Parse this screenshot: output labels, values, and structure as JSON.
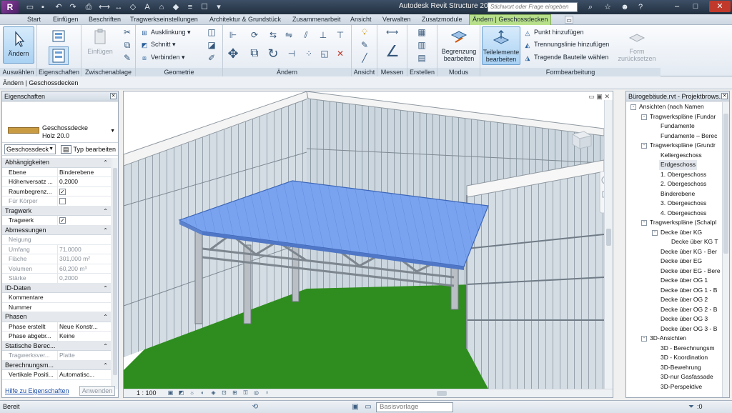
{
  "title_bar": {
    "logo_letter": "R",
    "window_title": "Autodesk Revit Structure 20...",
    "search_placeholder": "Stichwort oder Frage eingeben",
    "qat_icons": [
      "open-icon",
      "save-icon",
      "undo-icon",
      "redo-icon",
      "print-icon",
      "measure-icon",
      "dimension-icon",
      "tag-icon",
      "text-icon",
      "3d-view-icon",
      "section-icon",
      "thin-lines-icon",
      "close-hidden-icon",
      "switch-windows-icon"
    ],
    "right_icons": [
      "binoculars-icon",
      "star-icon",
      "user-icon",
      "help-icon"
    ]
  },
  "tabs": [
    {
      "label": "Start"
    },
    {
      "label": "Einfügen"
    },
    {
      "label": "Beschriften"
    },
    {
      "label": "Tragwerkseinstellungen"
    },
    {
      "label": "Architektur & Grundstück"
    },
    {
      "label": "Zusammenarbeit"
    },
    {
      "label": "Ansicht"
    },
    {
      "label": "Verwalten"
    },
    {
      "label": "Zusatzmodule"
    },
    {
      "label": "Ändern | Geschossdecken"
    }
  ],
  "ribbon": {
    "panels": [
      {
        "label": "Auswählen"
      },
      {
        "label": "Eigenschaften"
      },
      {
        "label": "Zwischenablage"
      },
      {
        "label": "Geometrie"
      },
      {
        "label": "Ändern"
      },
      {
        "label": "Ansicht"
      },
      {
        "label": "Messen"
      },
      {
        "label": "Erstellen"
      },
      {
        "label": "Modus"
      },
      {
        "label": "Formbearbeitung"
      }
    ],
    "modify_btn": "Ändern",
    "paste_btn": "Einfügen",
    "geometry": {
      "cope": "Ausklinkung",
      "cut": "Schnitt",
      "join": "Verbinden"
    },
    "mode": {
      "boundary_l1": "Begrenzung",
      "boundary_l2": "bearbeiten"
    },
    "shape": {
      "subelements_l1": "Teilelemente",
      "subelements_l2": "bearbeiten",
      "add_point": "Punkt hinzufügen",
      "add_split_line": "Trennungslinie hinzufügen",
      "pick_supports": "Tragende Bauteile wählen",
      "reset_l1": "Form",
      "reset_l2": "zurücksetzen"
    }
  },
  "context_bar": "Ändern | Geschossdecken",
  "properties": {
    "title": "Eigenschaften",
    "type_name": "Geschossdecke",
    "type_sub": "Holz 20.0",
    "instance_filter": "Geschossdeck",
    "edit_type": "Typ bearbeiten",
    "rows": [
      {
        "group": "Abhängigkeiten"
      },
      {
        "k": "Ebene",
        "v": "Binderebene"
      },
      {
        "k": "Höhenversatz ...",
        "v": "0,2000"
      },
      {
        "k": "Raumbegrenz...",
        "v": "",
        "check": true,
        "checked": true
      },
      {
        "k": "Für Körper",
        "v": "",
        "check": true,
        "checked": false,
        "grey": true
      },
      {
        "group": "Tragwerk"
      },
      {
        "k": "Tragwerk",
        "v": "",
        "check": true,
        "checked": true
      },
      {
        "group": "Abmessungen"
      },
      {
        "k": "Neigung",
        "v": "",
        "grey": true
      },
      {
        "k": "Umfang",
        "v": "71,0000",
        "grey": true
      },
      {
        "k": "Fläche",
        "v": "301,000 m²",
        "grey": true
      },
      {
        "k": "Volumen",
        "v": "60,200 m³",
        "grey": true
      },
      {
        "k": "Stärke",
        "v": "0,2000",
        "grey": true
      },
      {
        "group": "ID-Daten"
      },
      {
        "k": "Kommentare",
        "v": ""
      },
      {
        "k": "Nummer",
        "v": ""
      },
      {
        "group": "Phasen"
      },
      {
        "k": "Phase erstellt",
        "v": "Neue Konstr..."
      },
      {
        "k": "Phase abgebr...",
        "v": "Keine"
      },
      {
        "group": "Statische Berec..."
      },
      {
        "k": "Tragwerksver...",
        "v": "Platte",
        "grey": true
      },
      {
        "group": "Berechnungsm..."
      },
      {
        "k": "Vertikale Positi...",
        "v": "Automatisc..."
      }
    ],
    "help_link": "Hilfe zu Eigenschaften",
    "apply_btn": "Anwenden"
  },
  "view": {
    "scale": "1 : 100",
    "colors": {
      "floor": "#2f8d1f",
      "slab": "#7aa3ef",
      "glass": "#c9d5de",
      "frame": "#9aa4ab"
    }
  },
  "browser": {
    "title": "Bürogebäude.rvt - Projektbrows...",
    "tree": [
      {
        "lvl": 0,
        "exp": "-",
        "label": "Ansichten (nach Namen"
      },
      {
        "lvl": 1,
        "exp": "-",
        "label": "Tragwerkspläne (Fundar"
      },
      {
        "lvl": 2,
        "label": "Fundamente"
      },
      {
        "lvl": 2,
        "label": "Fundamente – Berec"
      },
      {
        "lvl": 1,
        "exp": "-",
        "label": "Tragwerkspläne (Grundr"
      },
      {
        "lvl": 2,
        "label": "Kellergeschoss"
      },
      {
        "lvl": 2,
        "label": "Erdgeschoss",
        "sel": true
      },
      {
        "lvl": 2,
        "label": "1. Obergeschoss"
      },
      {
        "lvl": 2,
        "label": "2. Obergeschoss"
      },
      {
        "lvl": 2,
        "label": "Binderebene"
      },
      {
        "lvl": 2,
        "label": "3. Obergeschoss"
      },
      {
        "lvl": 2,
        "label": "4. Obergeschoss"
      },
      {
        "lvl": 1,
        "exp": "-",
        "label": "Tragwerkspläne (Schalpl"
      },
      {
        "lvl": 2,
        "exp": "-",
        "label": "Decke über KG"
      },
      {
        "lvl": 3,
        "label": "Decke über KG T"
      },
      {
        "lvl": 2,
        "label": "Decke über KG - Ber"
      },
      {
        "lvl": 2,
        "label": "Decke über EG"
      },
      {
        "lvl": 2,
        "label": "Decke über EG - Bere"
      },
      {
        "lvl": 2,
        "label": "Decke über OG 1"
      },
      {
        "lvl": 2,
        "label": "Decke über OG 1 - B"
      },
      {
        "lvl": 2,
        "label": "Decke über OG 2"
      },
      {
        "lvl": 2,
        "label": "Decke über OG 2 - B"
      },
      {
        "lvl": 2,
        "label": "Decke über OG 3"
      },
      {
        "lvl": 2,
        "label": "Decke über OG 3 - B"
      },
      {
        "lvl": 1,
        "exp": "-",
        "label": "3D-Ansichten"
      },
      {
        "lvl": 2,
        "label": "3D - Berechnungsm"
      },
      {
        "lvl": 2,
        "label": "3D - Koordination"
      },
      {
        "lvl": 2,
        "label": "3D-Bewehrung"
      },
      {
        "lvl": 2,
        "label": "3D-nur Gasfassade"
      },
      {
        "lvl": 2,
        "label": "3D-Perspektive"
      }
    ]
  },
  "status": {
    "text": "Bereit",
    "model": "Basisvorlage",
    "filter_count": ":0"
  }
}
